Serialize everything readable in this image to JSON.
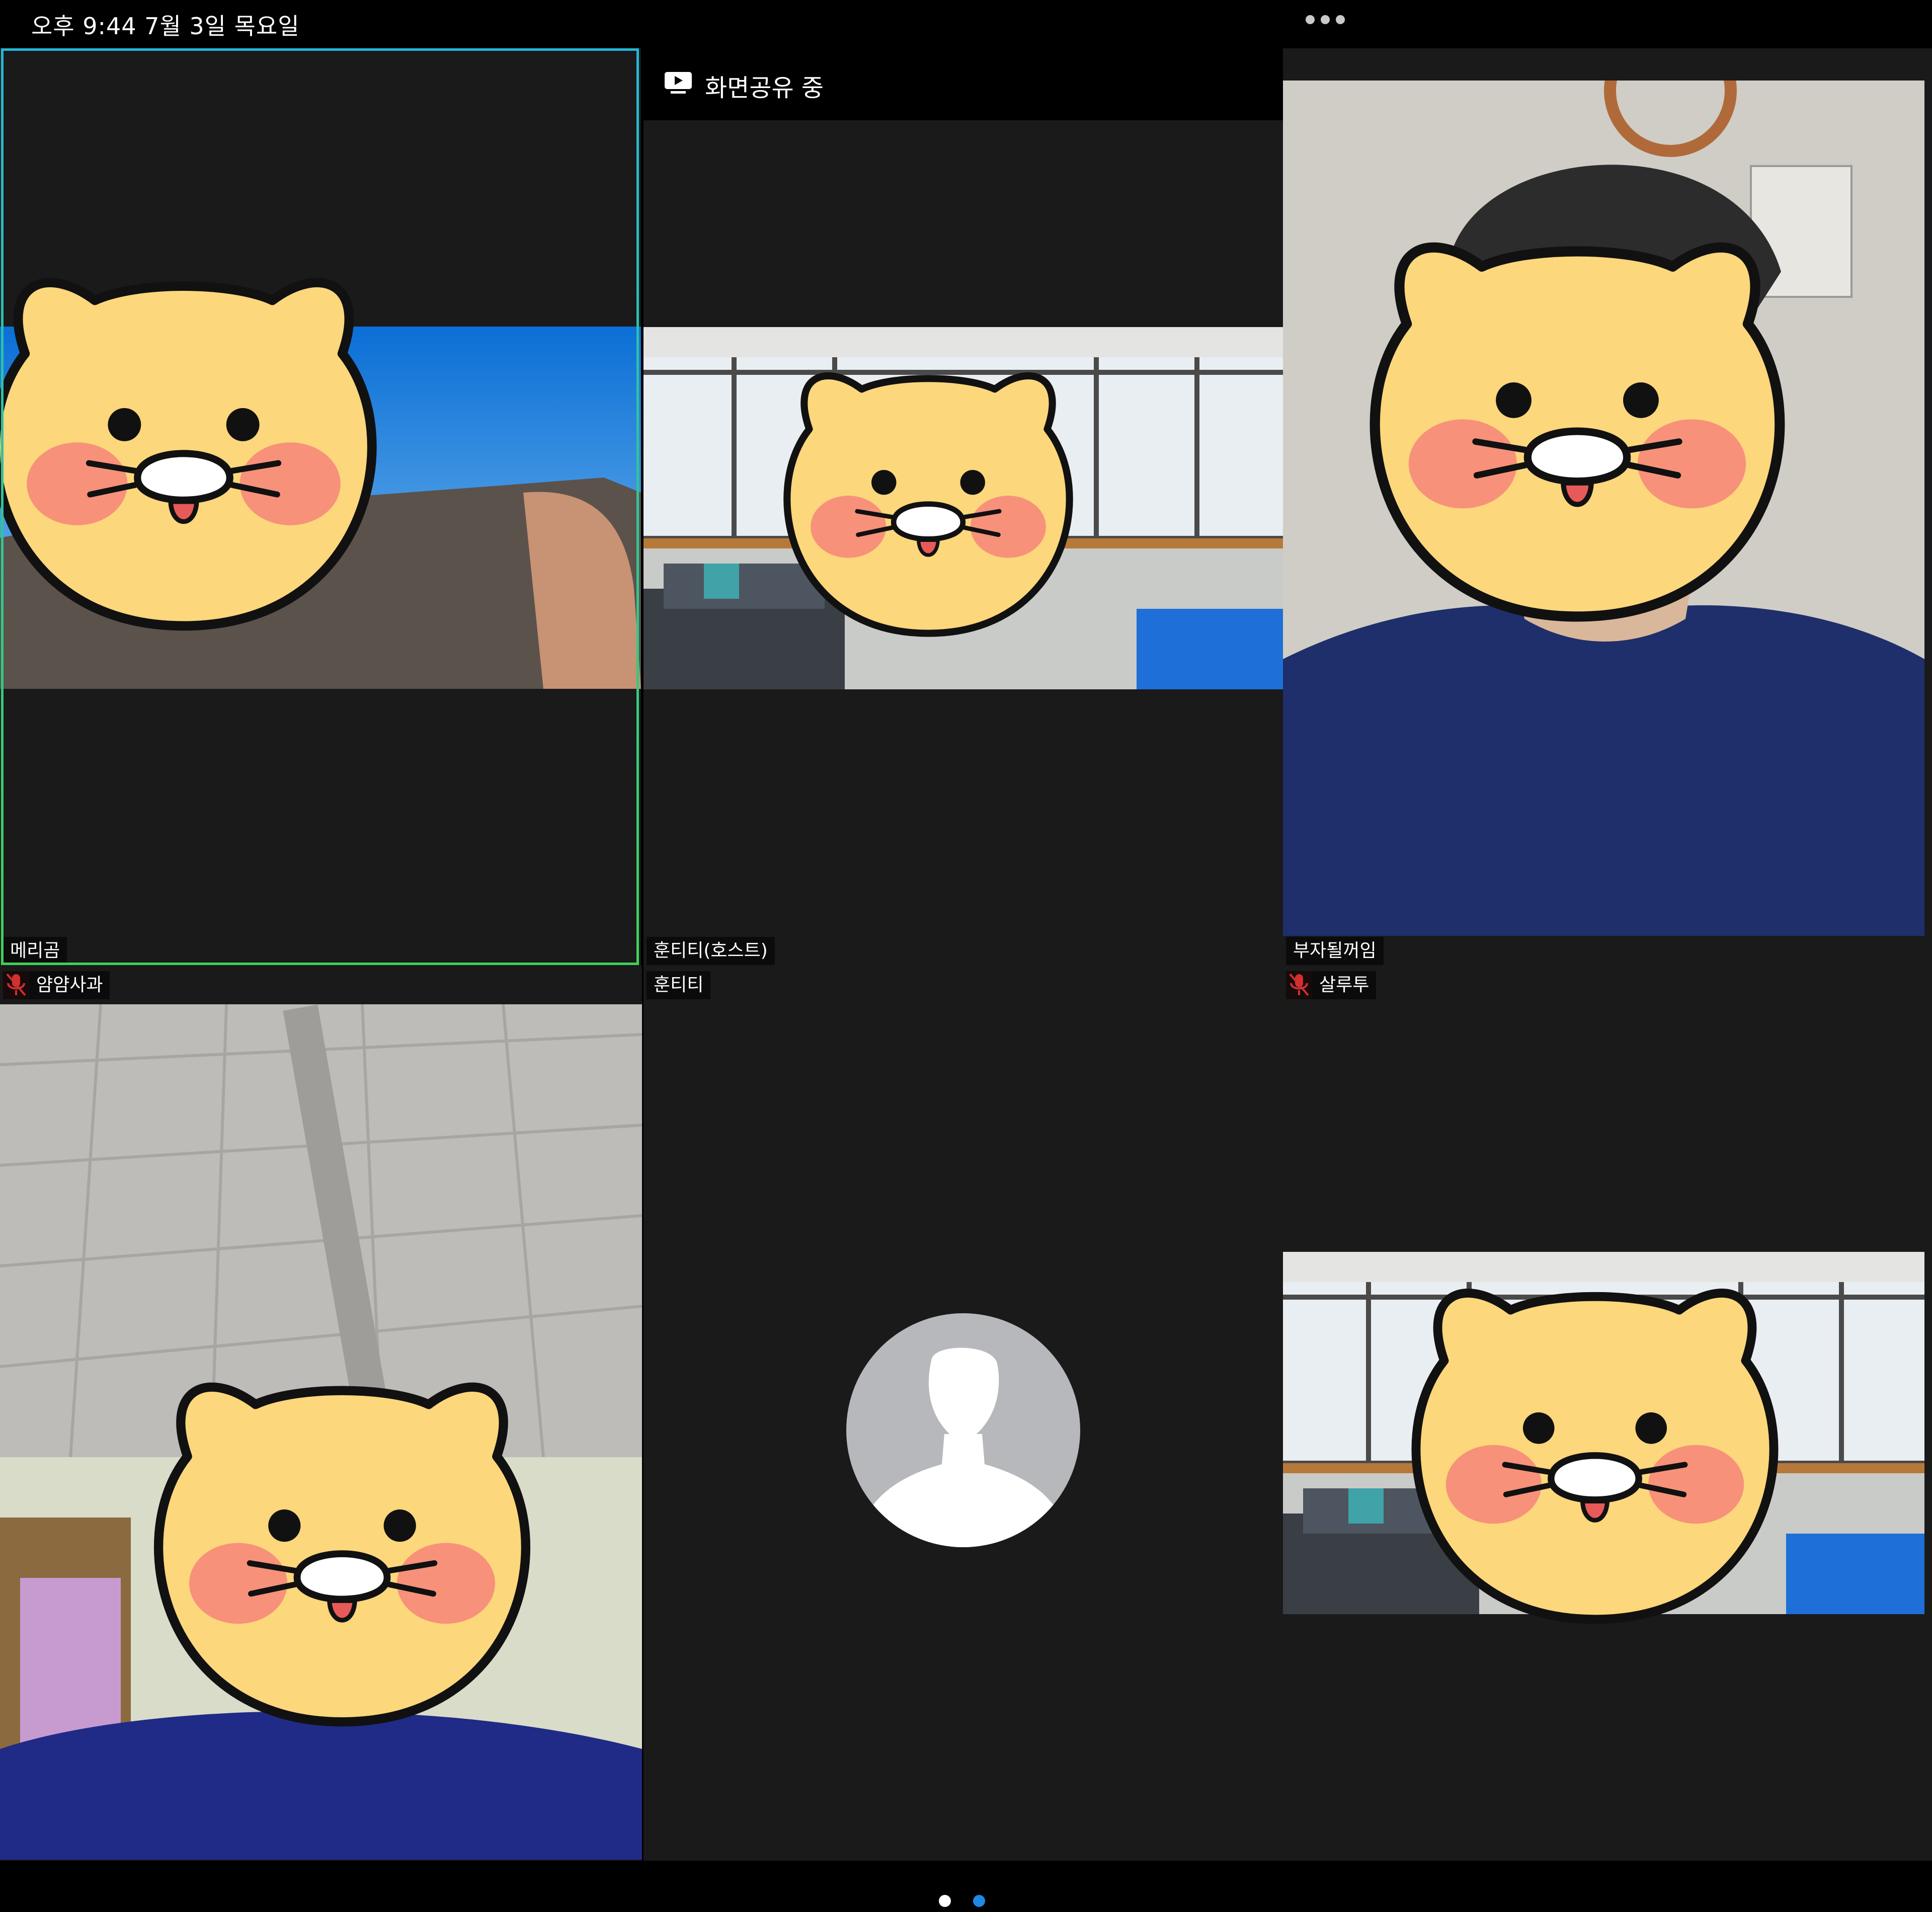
{
  "status_bar": {
    "text": "오후 9:44   7월 3일 목요일"
  },
  "more_menu": {
    "icon": "more-dots-icon"
  },
  "screen_share": {
    "label": "화면공유 중",
    "icon": "screen-share-icon"
  },
  "tiles": [
    {
      "id": "tile-merigom",
      "name": "메리곰",
      "avatar": "yellow-cat-face-sticker"
    },
    {
      "id": "tile-hoontt-host",
      "name": "훈티티(호스트)",
      "avatar": "yellow-cat-face-sticker"
    },
    {
      "id": "tile-bujadoelgeoim",
      "name": "부자될꺼임",
      "avatar": "yellow-cat-face-sticker"
    },
    {
      "id": "tile-yangyangsagwa",
      "name": "얌얌사과",
      "muted": true,
      "avatar": "yellow-cat-face-sticker"
    },
    {
      "id": "tile-hoontt",
      "name": "훈티티",
      "avatar": "default-profile-icon"
    },
    {
      "id": "tile-salrutu",
      "name": "살루투",
      "muted": true,
      "avatar": "yellow-cat-face-sticker"
    }
  ],
  "colors": {
    "background": "#000000",
    "tile_bg": "#1a1a1a",
    "active_speaker_border_top": "#25b6d6",
    "active_speaker_border_bottom": "#3fd05a",
    "page_dot_active": "#1e88e5",
    "page_dot_inactive": "#ffffff",
    "muted_mic": "#d32f2f"
  },
  "pagination": {
    "pages": 2,
    "current": 2
  }
}
